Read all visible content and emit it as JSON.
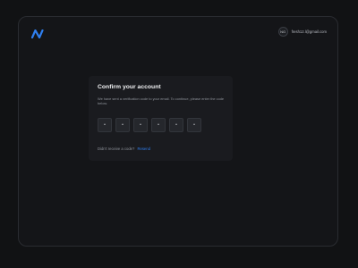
{
  "header": {
    "logo_icon": "n-logo-icon",
    "user": {
      "avatar_initials": "NG",
      "email": "fresh12.l@gmail.com"
    }
  },
  "card": {
    "title": "Confirm your account",
    "description": "We have sent a verification code to your email. To continue, please enter the code below.",
    "otp": {
      "digits": [
        "•",
        "•",
        "•",
        "•",
        "•",
        "•"
      ]
    },
    "resend": {
      "prompt": "Didn't receive a code?",
      "link_label": "Resend"
    }
  },
  "colors": {
    "accent": "#2f7ff0",
    "background": "#111214",
    "card": "#1a1b1f"
  }
}
